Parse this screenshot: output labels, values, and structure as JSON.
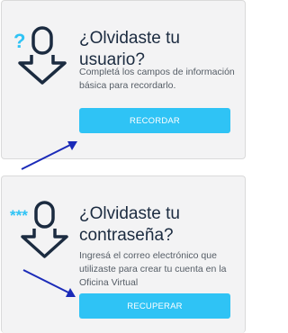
{
  "username_card": {
    "title_line1": "¿Olvidaste tu",
    "title_line2": "usuario?",
    "description": "Completá los campos de información básica para recordarlo.",
    "button_label": "RECORDAR",
    "icon": "person-question-icon"
  },
  "password_card": {
    "title_line1": "¿Olvidaste tu",
    "title_line2": "contraseña?",
    "description": "Ingresá el correo electrónico que utilizaste para crear tu cuenta en la Oficina Virtual",
    "button_label": "RECUPERAR",
    "icon": "person-password-icon"
  },
  "colors": {
    "accent": "#2fc3f5",
    "icon_outline": "#1b2b40",
    "arrow": "#1a2ab8",
    "card_bg": "#f3f3f4"
  }
}
